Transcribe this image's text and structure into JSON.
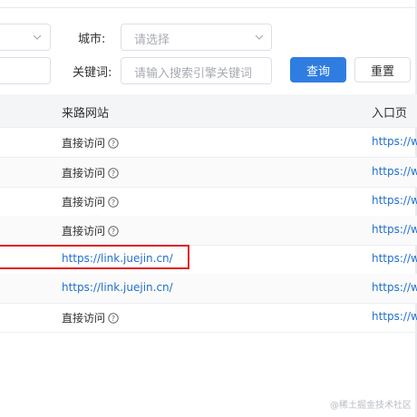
{
  "filters": {
    "city_label": "城市:",
    "city_placeholder": "请选择",
    "keyword_label": "关键词:",
    "keyword_placeholder": "请输入搜索引擎关键词",
    "search_button": "查询",
    "reset_button": "重置"
  },
  "table": {
    "columns": {
      "source": "来路网站",
      "entry": "入口页"
    },
    "rows": [
      {
        "source": "直接访问",
        "has_help_icon": true,
        "entry": "https://wv"
      },
      {
        "source": "直接访问",
        "has_help_icon": true,
        "entry": "https://wv"
      },
      {
        "source": "直接访问",
        "has_help_icon": true,
        "entry": "https://wv"
      },
      {
        "source": "直接访问",
        "has_help_icon": true,
        "entry": "https://wv"
      },
      {
        "source": "https://link.juejin.cn/",
        "has_help_icon": false,
        "entry": "https://wv",
        "highlighted": true
      },
      {
        "source": "https://link.juejin.cn/",
        "has_help_icon": false,
        "entry": "https://wv"
      },
      {
        "source": "直接访问",
        "has_help_icon": true,
        "entry": "https://wv"
      }
    ]
  },
  "watermark": "@稀土掘金技术社区",
  "colors": {
    "primary": "#2f7de1",
    "link": "#1f6fd1",
    "highlight_border": "#e21d1d"
  }
}
